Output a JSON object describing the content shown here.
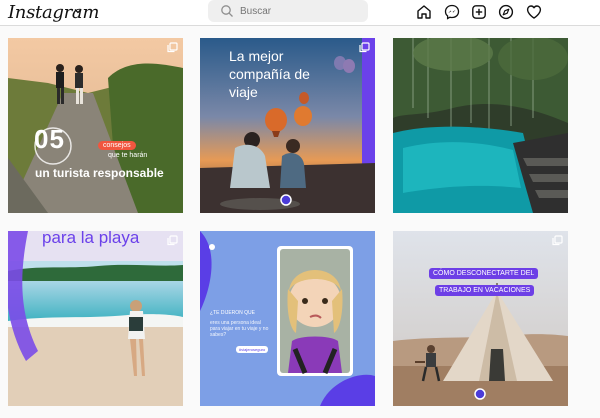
{
  "app": {
    "title": "Instagram"
  },
  "search": {
    "placeholder": "Buscar"
  },
  "nav": {
    "icons": [
      "home-icon",
      "messenger-icon",
      "new-post-icon",
      "explore-icon",
      "activity-heart-icon"
    ]
  },
  "posts": [
    {
      "id": "post-1",
      "type": "carousel",
      "number": "05",
      "pill": "consejos",
      "sub": "que te harán",
      "title": "un turista responsable"
    },
    {
      "id": "post-2",
      "type": "carousel",
      "title": "La mejor compañía de viaje"
    },
    {
      "id": "post-3",
      "type": "image"
    },
    {
      "id": "post-4",
      "type": "carousel",
      "title": "para la playa"
    },
    {
      "id": "post-5",
      "type": "image",
      "question": "¿TE DIJERON QUE",
      "body": "eres una persona ideal para viajar en tu viaje y no sabes?",
      "tag": "#viajeroseguro"
    },
    {
      "id": "post-6",
      "type": "carousel",
      "line1": "CÓMO DESCONECTARTE DEL",
      "line2": "TRABAJO EN VACACIONES"
    }
  ],
  "colors": {
    "accent": "#6b41ea",
    "coral": "#f1563f",
    "border": "#dbdbdb"
  }
}
